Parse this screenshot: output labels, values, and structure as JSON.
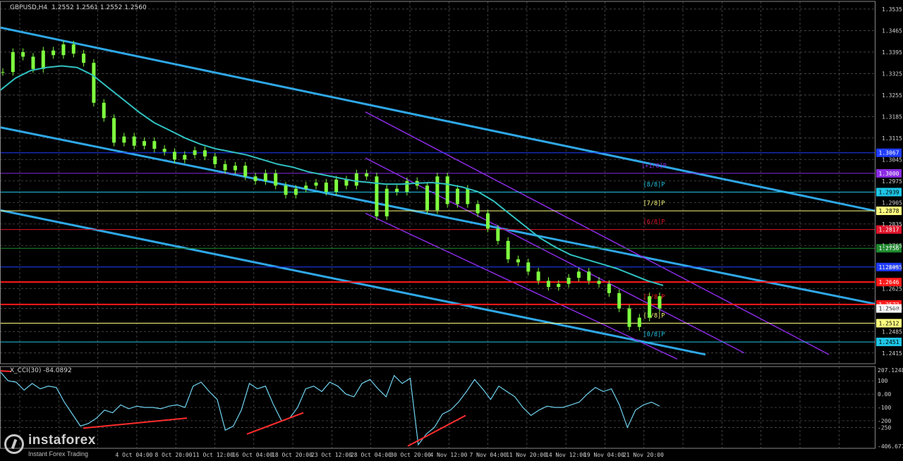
{
  "header": {
    "symbol": "GBPUSD,H4",
    "ohlc": "1.2552 1.2561 1.2552 1.2560"
  },
  "indicator": {
    "label": "X_CCI(30) -84.0892"
  },
  "logo": {
    "brand": "instaforex",
    "slogan": "Instant Forex Trading"
  },
  "colors": {
    "bg": "#000000",
    "grid": "#5a5a5a",
    "candle": "#7fff3f",
    "ma": "#31c1c1",
    "channel": "#2fa7e6",
    "purple": "#8a2be2",
    "red": "#ff1a1a",
    "cci": "#6fd3f0",
    "divergence": "#ff2d2d"
  },
  "chart_data": [
    {
      "type": "line",
      "name": "price",
      "ylim": [
        1.238,
        1.356
      ],
      "y_ticks": [
        "1.3535",
        "1.3465",
        "1.3395",
        "1.3325",
        "1.3255",
        "1.3185",
        "1.3115",
        "1.3045",
        "1.2975",
        "1.2905",
        "1.2835",
        "1.2765",
        "1.2695",
        "1.2625",
        "1.2560",
        "1.2485",
        "1.2415"
      ],
      "x_ticks": [
        "4 Oct 04:00",
        "8 Oct 20:00",
        "11 Oct 12:00",
        "16 Oct 04:00",
        "18 Oct 20:00",
        "23 Oct 12:00",
        "28 Oct 04:00",
        "30 Oct 20:00",
        "4 Nov 12:00",
        "7 Nov 04:00",
        "11 Nov 20:00",
        "14 Nov 12:00",
        "19 Nov 04:00",
        "21 Nov 20:00"
      ],
      "price_close_series": [
        1.333,
        1.3395,
        1.338,
        1.334,
        1.34,
        1.3385,
        1.342,
        1.339,
        1.336,
        1.323,
        1.318,
        1.31,
        1.312,
        1.309,
        1.3105,
        1.308,
        1.307,
        1.3045,
        1.306,
        1.3075,
        1.3055,
        1.303,
        1.301,
        1.3025,
        1.299,
        1.2975,
        1.3,
        1.296,
        1.293,
        1.295,
        1.296,
        1.297,
        1.294,
        1.298,
        1.296,
        1.3,
        1.299,
        1.286,
        1.295,
        1.294,
        1.2975,
        1.296,
        1.288,
        1.299,
        1.29,
        1.295,
        1.29,
        1.287,
        1.282,
        1.278,
        1.272,
        1.271,
        1.268,
        1.265,
        1.263,
        1.264,
        1.266,
        1.268,
        1.265,
        1.264,
        1.261,
        1.256,
        1.25,
        1.253,
        1.26,
        1.256
      ],
      "ma_series": [
        1.327,
        1.331,
        1.3335,
        1.3345,
        1.335,
        1.3345,
        1.332,
        1.328,
        1.324,
        1.32,
        1.3165,
        1.314,
        1.3115,
        1.3095,
        1.308,
        1.307,
        1.306,
        1.3045,
        1.303,
        1.302,
        1.3005,
        1.2995,
        1.2985,
        1.2975,
        1.297,
        1.2965,
        1.2965,
        1.2968,
        1.297,
        1.2965,
        1.2955,
        1.294,
        1.291,
        1.287,
        1.283,
        1.279,
        1.276,
        1.2735,
        1.272,
        1.2705,
        1.269,
        1.267,
        1.265,
        1.2635
      ],
      "levels": [
        {
          "label": "1.3067",
          "value": 1.3067,
          "tag": "",
          "color": "#1f3cff"
        },
        {
          "label": "1.3000",
          "value": 1.3,
          "tag": "[+1/8]P",
          "color": "#8a2be2"
        },
        {
          "label": "1.2939",
          "value": 1.2939,
          "tag": "[8/8]P",
          "color": "#1fc6e6"
        },
        {
          "label": "1.2878",
          "value": 1.2878,
          "tag": "[7/8]P",
          "color": "#ffff80"
        },
        {
          "label": "1.2817",
          "value": 1.2817,
          "tag": "[6/8]P",
          "color": "#e0142b"
        },
        {
          "label": "1.2756",
          "value": 1.2756,
          "tag": "",
          "color": "#1d8a2d"
        },
        {
          "label": "1.2695",
          "value": 1.2695,
          "tag": "",
          "color": "#1f3cff"
        },
        {
          "label": "1.2646",
          "value": 1.2646,
          "tag": "",
          "color": "#ff1a1a"
        },
        {
          "label": "1.2573",
          "value": 1.2573,
          "tag": "[2/8]P",
          "color": "#ff1a1a"
        },
        {
          "label": "1.2512",
          "value": 1.2512,
          "tag": "[1/8]P",
          "color": "#ffff80"
        },
        {
          "label": "1.2451",
          "value": 1.2451,
          "tag": "[0/8]P",
          "color": "#1fc6e6"
        }
      ],
      "current": {
        "label": "1.2560",
        "value": 1.256
      }
    },
    {
      "type": "line",
      "name": "X_CCI(30)",
      "ylim": [
        -406.677,
        207.1248
      ],
      "y_ticks": [
        "207.1248",
        "100",
        "0.00",
        "-100",
        "-200",
        "-250",
        "-406.677"
      ],
      "values": [
        170,
        100,
        90,
        30,
        80,
        40,
        60,
        50,
        -60,
        -150,
        -240,
        -220,
        -180,
        -120,
        -140,
        -80,
        -110,
        -90,
        -100,
        -100,
        -110,
        -90,
        -80,
        -100,
        60,
        90,
        20,
        -40,
        -270,
        -240,
        -120,
        80,
        40,
        60,
        -80,
        -200,
        -180,
        -100,
        40,
        60,
        20,
        90,
        60,
        0,
        -20,
        80,
        110,
        40,
        -20,
        140,
        80,
        120,
        -380,
        -300,
        -250,
        -150,
        -120,
        -60,
        20,
        110,
        40,
        -40,
        60,
        20,
        -20,
        -100,
        -160,
        -120,
        -90,
        -100,
        -100,
        -80,
        -60,
        0,
        50,
        20,
        40,
        -80,
        -250,
        -120,
        -80,
        -60,
        -90
      ]
    }
  ]
}
